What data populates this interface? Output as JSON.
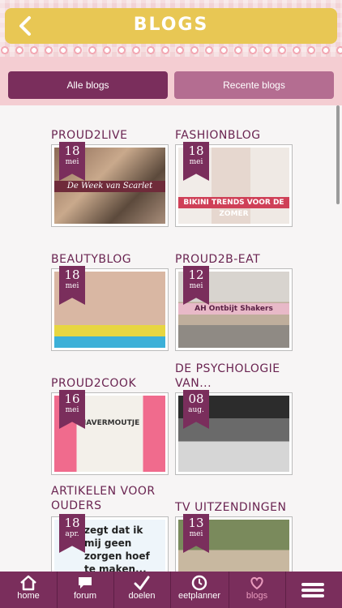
{
  "header": {
    "title": "BLOGS",
    "back_icon": "chevron-left-icon"
  },
  "tabs": [
    {
      "label": "Alle blogs",
      "active": true
    },
    {
      "label": "Recente blogs",
      "active": false
    }
  ],
  "blogs": [
    {
      "title": "PROUD2LIVE",
      "day": "18",
      "month": "mei",
      "caption": "De Week van Scarlet"
    },
    {
      "title": "FASHIONBLOG",
      "day": "18",
      "month": "mei",
      "caption": "BIKINI TRENDS VOOR DE ZOMER"
    },
    {
      "title": "BEAUTYBLOG",
      "day": "18",
      "month": "mei",
      "caption": ""
    },
    {
      "title": "PROUD2B-EAT",
      "day": "12",
      "month": "mei",
      "caption": "AH Ontbijt Shakers"
    },
    {
      "title": "PROUD2COOK",
      "day": "16",
      "month": "mei",
      "caption": "HAVERMOUTJE"
    },
    {
      "title": "DE PSYCHOLOGIE VAN...",
      "day": "08",
      "month": "aug.",
      "caption": ""
    },
    {
      "title": "ARTIKELEN VOOR OUDERS",
      "day": "18",
      "month": "apr.",
      "caption": "zegt dat ik mij geen zorgen hoef te maken..."
    },
    {
      "title": "TV UITZENDINGEN",
      "day": "13",
      "month": "mei",
      "caption": ""
    }
  ],
  "nav": [
    {
      "label": "home",
      "icon": "home-icon"
    },
    {
      "label": "forum",
      "icon": "chat-icon"
    },
    {
      "label": "doelen",
      "icon": "checkmark-icon"
    },
    {
      "label": "eetplanner",
      "icon": "clock-icon"
    },
    {
      "label": "blogs",
      "icon": "heart-icon",
      "active": true
    }
  ],
  "menu_icon": "hamburger-menu-icon",
  "colors": {
    "primary": "#7a2e5c",
    "secondary": "#b46d91",
    "header": "#e8c754",
    "pattern": "#f2d3d6",
    "nav_active": "#e99bbd"
  }
}
